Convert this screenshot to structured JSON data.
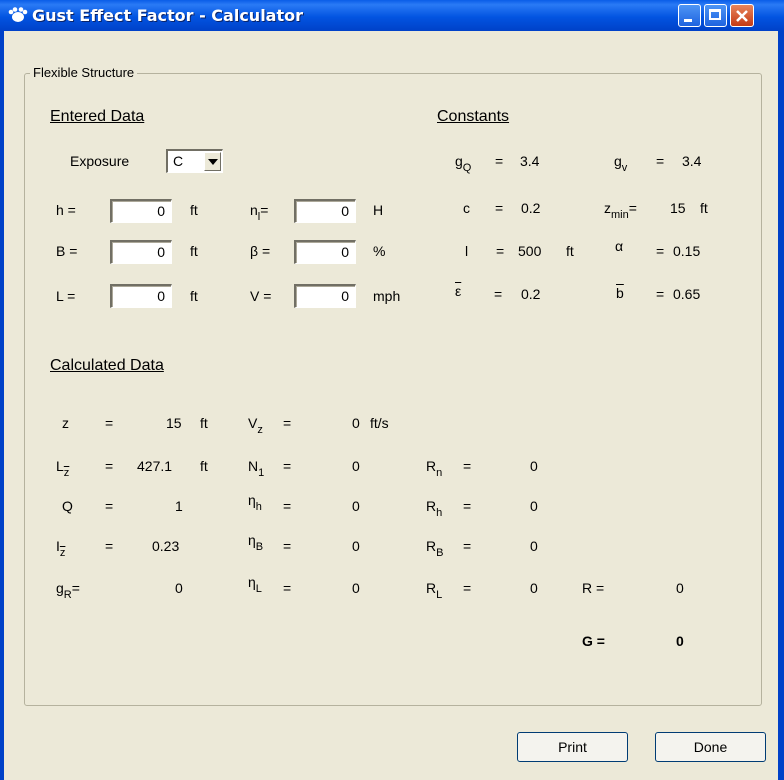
{
  "window": {
    "title": "Gust Effect Factor - Calculator"
  },
  "group": {
    "label": "Flexible Structure"
  },
  "entered": {
    "heading": "Entered Data",
    "exposure_label": "Exposure",
    "exposure_value": "C",
    "h_label": "h =",
    "h_value": "0",
    "h_unit": "ft",
    "B_label": "B =",
    "B_value": "0",
    "B_unit": "ft",
    "L_label": "L =",
    "L_value": "0",
    "L_unit": "ft",
    "n1_label": "n",
    "n1_sub": "l",
    "n1_eq": "=",
    "n1_value": "0",
    "n1_unit": "H",
    "beta_label": "β =",
    "beta_value": "0",
    "beta_unit": "%",
    "V_label": "V =",
    "V_value": "0",
    "V_unit": "mph"
  },
  "constants": {
    "heading": "Constants",
    "gQ_label": "g",
    "gQ_sub": "Q",
    "gQ_eq": "=",
    "gQ_value": "3.4",
    "gV_label": "g",
    "gV_sub": "v",
    "gV_eq": "=",
    "gV_value": "3.4",
    "c_label": "c",
    "c_eq": "=",
    "c_value": "0.2",
    "zmin_label": "z",
    "zmin_sub": "min",
    "zmin_eq": "=",
    "zmin_value": "15",
    "zmin_unit": "ft",
    "l_label": "l",
    "l_eq": "=",
    "l_value": "500",
    "l_unit": "ft",
    "alpha_label": "α",
    "alpha_eq": "=",
    "alpha_value": "0.15",
    "eps_label": "ε",
    "eps_eq": "=",
    "eps_value": "0.2",
    "b_label": "b",
    "b_eq": "=",
    "b_value": "0.65"
  },
  "calculated": {
    "heading": "Calculated Data",
    "z_label": "z",
    "z_eq": "=",
    "z_value": "15",
    "z_unit": "ft",
    "Vz_label": "V",
    "Vz_sub": "z",
    "Vz_eq": "=",
    "Vz_value": "0",
    "Vz_unit": "ft/s",
    "Lz_label": "L",
    "Lz_sub": "z",
    "Lz_eq": "=",
    "Lz_value": "427.1",
    "Lz_unit": "ft",
    "N1_label": "N",
    "N1_sub": "1",
    "N1_eq": "=",
    "N1_value": "0",
    "Rn_label": "R",
    "Rn_sub": "n",
    "Rn_eq": "=",
    "Rn_value": "0",
    "Q_label": "Q",
    "Q_eq": "=",
    "Q_value": "1",
    "eta_h_label": "η",
    "eta_h_sub": "h",
    "eta_h_eq": "=",
    "eta_h_value": "0",
    "Rh_label": "R",
    "Rh_sub": "h",
    "Rh_eq": "=",
    "Rh_value": "0",
    "Iz_label": "I",
    "Iz_sub": "z",
    "Iz_eq": "=",
    "Iz_value": "0.23",
    "eta_B_label": "η",
    "eta_B_sub": "B",
    "eta_B_eq": "=",
    "eta_B_value": "0",
    "RB_label": "R",
    "RB_sub": "B",
    "RB_eq": "=",
    "RB_value": "0",
    "gR_label": "g",
    "gR_sub": "R",
    "gR_eq": "=",
    "gR_value": "0",
    "eta_L_label": "η",
    "eta_L_sub": "L",
    "eta_L_eq": "=",
    "eta_L_value": "0",
    "RL_label": "R",
    "RL_sub": "L",
    "RL_eq": "=",
    "RL_value": "0",
    "R_label": "R =",
    "R_value": "0",
    "G_label": "G =",
    "G_value": "0"
  },
  "buttons": {
    "print": "Print",
    "done": "Done"
  },
  "colors": {
    "titlebar": "#0254e1",
    "face": "#ece9d8",
    "close": "#c43a14"
  },
  "icons": {
    "app": "paw-icon",
    "minimize": "minimize-icon",
    "maximize": "maximize-icon",
    "close": "close-icon",
    "dropdown": "chevron-down-icon"
  }
}
